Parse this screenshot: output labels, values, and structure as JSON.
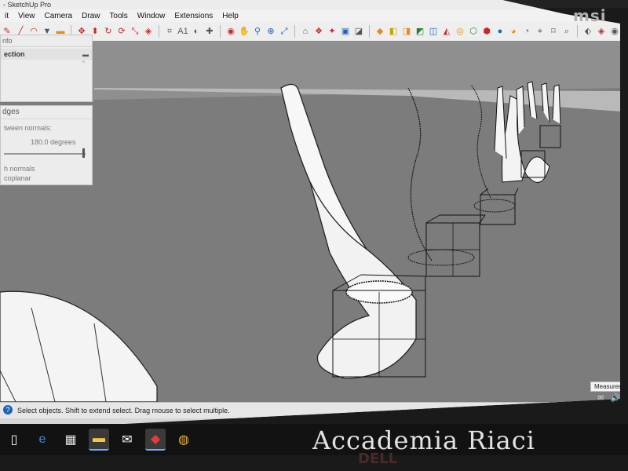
{
  "window": {
    "title": "- SketchUp Pro"
  },
  "menu": [
    "it",
    "View",
    "Camera",
    "Draw",
    "Tools",
    "Window",
    "Extensions",
    "Help"
  ],
  "toolbar": {
    "icons": [
      "pencil-icon",
      "line-icon",
      "arc-icon",
      "shape-icon",
      "eraser-icon",
      "paint-icon",
      "move-icon",
      "rotate-icon",
      "scale-icon",
      "push-pull-icon",
      "offset-icon",
      "tape-icon",
      "dimension-icon",
      "protractor-icon",
      "text-icon",
      "axes-icon",
      "orbit-icon",
      "pan-icon",
      "zoom-icon",
      "zoom-extents-icon",
      "warehouse-icon",
      "components-icon",
      "extension-warehouse-icon",
      "layout-icon",
      "style-icon"
    ]
  },
  "tray": {
    "entity_info": {
      "header": "nfo",
      "section": "ection"
    },
    "soften_edges": {
      "header": "dges",
      "row1": "tween normals:",
      "value": "180.0  degrees",
      "row3": "h normals",
      "row4": "coplanar",
      "slider_value": 1.0
    }
  },
  "viewport": {
    "background": "#8f8f8f",
    "ground": "#7a7a7a"
  },
  "status": {
    "text": "Select objects. Shift to extend select. Drag mouse to select multiple.",
    "help": "?"
  },
  "measurements": {
    "label": "Measurements"
  },
  "monitor": {
    "brand": "msi",
    "logo": "DELL"
  },
  "watermark": "Accademia Riaci",
  "taskbar": {
    "icons": [
      "windows-icon",
      "search-icon",
      "task-view-icon",
      "edge-icon",
      "store-icon",
      "file-explorer-icon",
      "mail-icon",
      "sketchup-icon",
      "chrome-icon"
    ]
  }
}
